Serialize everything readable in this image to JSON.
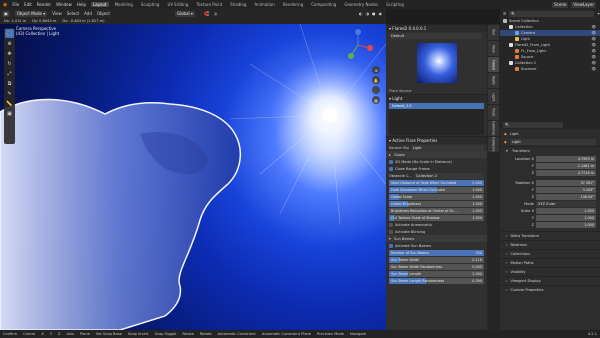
{
  "topbar": {
    "menus": [
      "File",
      "Edit",
      "Render",
      "Window",
      "Help"
    ],
    "workspaces": [
      "Layout",
      "Modeling",
      "Sculpting",
      "UV Editing",
      "Texture Paint",
      "Shading",
      "Animation",
      "Rendering",
      "Compositing",
      "Geometry Nodes",
      "Scripting"
    ],
    "scene": "Scene",
    "view_layer": "ViewLayer"
  },
  "vp_header": {
    "mode": "Object Mode",
    "menus": [
      "View",
      "Select",
      "Add",
      "Object"
    ],
    "orientation": "Global"
  },
  "vp_status": {
    "dx": "Dx: 1.412 m",
    "dy": "Dy: 0.6043 m",
    "dz": "Dz: -0.483 m (1.627 m)"
  },
  "viewport": {
    "camera": "Camera Perspective",
    "collection": "(43) Collection | Light"
  },
  "props": {
    "addon": "Flared2 0.4.0.0.1",
    "preset": "Default",
    "flare_source": "Flare Source",
    "source_header": "Light",
    "source_item": "Default_2.0",
    "active_elements": "Active Flare Properties",
    "source_obj_label": "Source Obj",
    "source_obj": "Light",
    "glows": "Glows",
    "mode_2d": "2D Mode (No Scale in Distance)",
    "close_range": "Close Range Frame",
    "obstacle_label": "Obstacle C...",
    "obstacle": "Collection 2",
    "bars": [
      {
        "label": "Start Distance of Fade When Occluded",
        "value": "2.000",
        "frac": 1.0
      },
      {
        "label": "Fade Slowdown When Occluded",
        "value": "1.000",
        "frac": 0.5
      },
      {
        "label": "Global Scale",
        "value": "1.000",
        "frac": 0.1
      },
      {
        "label": "Global Brightness",
        "value": "1.000",
        "frac": 0.2
      },
      {
        "label": "Brightness Reduction at Center of Sc...",
        "value": "1.000",
        "frac": 0.0
      },
      {
        "label": "Ctrl Texture Scale of Shadow",
        "value": "1.000",
        "frac": 0.05
      }
    ],
    "activate_anamorphic": "Activate Anamorphic",
    "activate_blinking": "Activate Blinking",
    "sun_beams": "Sun Beams",
    "activate_sun_beams": "Activate Sun Beams",
    "beam_bars": [
      {
        "label": "Number of Sun Beams",
        "value": "300",
        "frac": 1.0
      },
      {
        "label": "Sun Beam Width",
        "value": "0.118",
        "frac": 0.12
      },
      {
        "label": "Sun Beam Width Randomness",
        "value": "0.000",
        "frac": 0.0
      },
      {
        "label": "Sun Beam Length",
        "value": "2.000",
        "frac": 0.2
      },
      {
        "label": "Sun Beam Length Randomness",
        "value": "0.390",
        "frac": 0.39
      }
    ]
  },
  "tabs": [
    "Tool",
    "View",
    "Flared",
    "Rigify",
    "Light",
    "Track",
    "Cameras",
    "Compute"
  ],
  "outliner": {
    "title": "Scene Collection",
    "rows": [
      {
        "name": "Collection",
        "depth": 1,
        "color": "#dddddd",
        "sel": false
      },
      {
        "name": "Camera",
        "depth": 2,
        "color": "#66a9d8",
        "sel": true
      },
      {
        "name": "Light",
        "depth": 2,
        "color": "#e8c04a",
        "sel": false
      },
      {
        "name": "Flared2_From_Light",
        "depth": 1,
        "color": "#dddddd",
        "sel": false
      },
      {
        "name": "FL_Fuse_Light",
        "depth": 2,
        "color": "#e07d3c",
        "sel": false
      },
      {
        "name": "Source",
        "depth": 2,
        "color": "#e07d3c",
        "sel": false
      },
      {
        "name": "Collection 2",
        "depth": 1,
        "color": "#dddddd",
        "sel": false
      },
      {
        "name": "Suzanne",
        "depth": 2,
        "color": "#e07d3c",
        "sel": false
      }
    ]
  },
  "object": {
    "name": "Light",
    "sub": "Light",
    "transform": "Transform",
    "location": [
      [
        "Location X",
        "4.7963 m"
      ],
      [
        "Y",
        "1.1461 m"
      ],
      [
        "Z",
        "4.7716 m"
      ]
    ],
    "rotation": [
      [
        "Rotation X",
        "37.261°"
      ],
      [
        "Y",
        "3.163°"
      ],
      [
        "Z",
        "106.94°"
      ]
    ],
    "mode_label": "Mode",
    "mode": "XYZ Euler",
    "scale": [
      [
        "Scale X",
        "1.000"
      ],
      [
        "Y",
        "1.000"
      ],
      [
        "Z",
        "1.000"
      ]
    ],
    "sections": [
      "Delta Transform",
      "Relations",
      "Collections",
      "Motion Paths",
      "Visibility",
      "Viewport Display",
      "Custom Properties"
    ]
  },
  "statusbar": {
    "items": [
      "Confirm",
      "Cancel",
      "X",
      "Y",
      "Z",
      "Axis",
      "Plane",
      "Set Snap Base",
      "Snap Invert",
      "Snap Toggle",
      "Resize",
      "Rotate",
      "Automatic Constraint",
      "Automatic Constraint Plane",
      "Precision Mode",
      "Navigate"
    ],
    "version": "4.2.1"
  }
}
